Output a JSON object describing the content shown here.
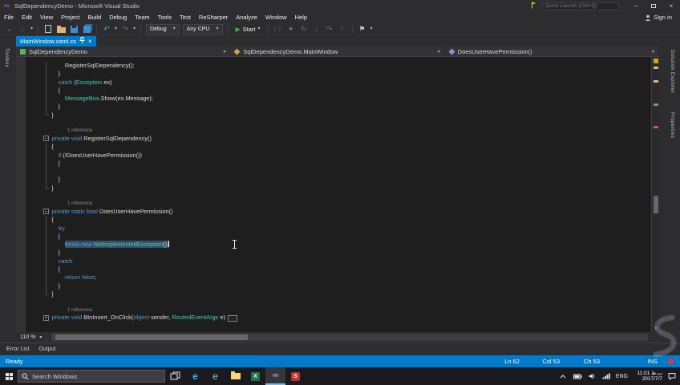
{
  "window": {
    "title": "SqlDependencyDemo - Microsoft Visual Studio",
    "quick_launch_placeholder": "Quick Launch (Ctrl+Q)",
    "sign_in_label": "Sign in"
  },
  "icons": {
    "chevron_down": "▾",
    "close": "×",
    "minimize": "–",
    "back": "←",
    "forward": "→",
    "undo": "↶",
    "redo": "↷",
    "play": "▶",
    "pause": "❘❘",
    "stop": "■",
    "restart": "↻",
    "step_into": "↓",
    "step_over": "↷",
    "step_out": "↑",
    "flag": "⚑",
    "scroll_up": "▲",
    "scroll_down": "▼",
    "infinity": "∞"
  },
  "menu": {
    "items": [
      "File",
      "Edit",
      "View",
      "Project",
      "Build",
      "Debug",
      "Team",
      "Tools",
      "Test",
      "ReSharper",
      "Analyze",
      "Window",
      "Help"
    ]
  },
  "toolbar": {
    "configuration": "Debug",
    "platform": "Any CPU",
    "start_label": "Start"
  },
  "tab_strip": {
    "tabs": [
      {
        "label": "MainWindow.xaml.cs",
        "active": true
      }
    ]
  },
  "navigation_bar": {
    "segments": [
      {
        "label": "SqlDependencyDemo",
        "icon": "csharp-project"
      },
      {
        "label": "SqlDependencyDemo.MainWindow",
        "icon": "class"
      },
      {
        "label": "DoesUserHavePermission()",
        "icon": "method"
      }
    ]
  },
  "side_rails": {
    "left": [
      "Toolbox"
    ],
    "right": [
      "Solution Explorer",
      "Properties"
    ]
  },
  "editor": {
    "zoom_level": "110 %",
    "lines": [
      {
        "fold": "bar",
        "segs": [
          [
            "pl",
            "                RegisterSqlDependency();"
          ]
        ]
      },
      {
        "fold": "bar",
        "segs": [
          [
            "pl",
            "            }"
          ]
        ]
      },
      {
        "fold": "bar",
        "segs": [
          [
            "kw",
            "            catch"
          ],
          [
            "pl",
            " ("
          ],
          [
            "ty",
            "Exception"
          ],
          [
            "pl",
            " ex)"
          ]
        ]
      },
      {
        "fold": "bar",
        "segs": [
          [
            "pl",
            "            {"
          ]
        ]
      },
      {
        "fold": "bar",
        "segs": [
          [
            "ty",
            "                MessageBox"
          ],
          [
            "pl",
            ".Show(ex.Message);"
          ]
        ]
      },
      {
        "fold": "bar",
        "segs": [
          [
            "pl",
            "            }"
          ]
        ]
      },
      {
        "fold": "corner",
        "segs": [
          [
            "pl",
            "        }"
          ]
        ]
      },
      {
        "segs": []
      },
      {
        "lens": true,
        "segs": [
          [
            "cl",
            "1 reference"
          ]
        ]
      },
      {
        "fold": "minus",
        "segs": [
          [
            "kw",
            "        private void "
          ],
          [
            "pl",
            "RegisterSqlDependency()"
          ]
        ]
      },
      {
        "fold": "bar",
        "segs": [
          [
            "pl",
            "        {"
          ]
        ]
      },
      {
        "fold": "bar",
        "segs": [
          [
            "kw",
            "            if"
          ],
          [
            "pl",
            " (!DoesUserHavePermission())"
          ]
        ]
      },
      {
        "fold": "bar",
        "segs": [
          [
            "pl",
            "            {"
          ]
        ]
      },
      {
        "fold": "bar",
        "segs": []
      },
      {
        "fold": "bar",
        "segs": [
          [
            "pl",
            "            }"
          ]
        ]
      },
      {
        "fold": "corner",
        "segs": [
          [
            "pl",
            "        }"
          ]
        ]
      },
      {
        "segs": []
      },
      {
        "lens": true,
        "segs": [
          [
            "cl",
            "1 reference"
          ]
        ]
      },
      {
        "fold": "minus",
        "segs": [
          [
            "kw",
            "        private static bool "
          ],
          [
            "pl",
            "DoesUserHavePermission()"
          ]
        ]
      },
      {
        "fold": "bar",
        "segs": [
          [
            "pl",
            "        {"
          ]
        ]
      },
      {
        "fold": "bar",
        "segs": [
          [
            "kw",
            "            try"
          ]
        ]
      },
      {
        "fold": "bar",
        "segs": [
          [
            "pl",
            "            {"
          ]
        ]
      },
      {
        "fold": "bar",
        "caret": true,
        "segs": [
          [
            "pl",
            "                "
          ],
          [
            "kw sel",
            "throw new "
          ],
          [
            "ty sel",
            "NotImplementedException"
          ],
          [
            "pl sel",
            "();"
          ]
        ]
      },
      {
        "fold": "bar",
        "segs": [
          [
            "pl",
            "            }"
          ]
        ]
      },
      {
        "fold": "bar",
        "segs": [
          [
            "kw",
            "            catch"
          ]
        ]
      },
      {
        "fold": "bar",
        "segs": [
          [
            "pl",
            "            {"
          ]
        ]
      },
      {
        "fold": "bar",
        "segs": [
          [
            "kw",
            "                return false"
          ],
          [
            "pl",
            ";"
          ]
        ]
      },
      {
        "fold": "bar",
        "segs": [
          [
            "pl",
            "            }"
          ]
        ]
      },
      {
        "fold": "corner",
        "segs": [
          [
            "pl",
            "        }"
          ]
        ]
      },
      {
        "segs": []
      },
      {
        "lens": true,
        "segs": [
          [
            "cl",
            "1 reference"
          ]
        ]
      },
      {
        "fold": "plus",
        "segs": [
          [
            "kw",
            "        private void "
          ],
          [
            "pl",
            "BtnInsert_OnClick("
          ],
          [
            "kw",
            "object"
          ],
          [
            "pl",
            " sender, "
          ],
          [
            "ty",
            "RoutedEventArgs"
          ],
          [
            "pl",
            " e)"
          ],
          [
            "bx",
            "..."
          ]
        ]
      }
    ],
    "scroll_marks": [
      {
        "pos": 0.035,
        "color": "#d7ba7d"
      },
      {
        "pos": 0.085,
        "color": "#d7ba7d"
      },
      {
        "pos": 0.17,
        "color": "#8a8a8a"
      },
      {
        "pos": 0.25,
        "color": "#e05252"
      }
    ],
    "thumb": {
      "pos": 0.505,
      "size": 0.065
    }
  },
  "bottom_panel": {
    "tabs": [
      "Error List",
      "Output"
    ]
  },
  "status_bar": {
    "message": "Ready",
    "line": "Ln 62",
    "column": "Col 53",
    "character": "Ch 53",
    "mode": "INS"
  },
  "taskbar": {
    "search_placeholder": "Search Windows",
    "apps": [
      {
        "name": "task-view"
      },
      {
        "name": "edge",
        "glyph": "e"
      },
      {
        "name": "internet-explorer",
        "glyph": "e"
      },
      {
        "name": "file-explorer"
      },
      {
        "name": "excel",
        "glyph": "X"
      },
      {
        "name": "visual-studio",
        "glyph": "∞",
        "active": true
      },
      {
        "name": "ssms",
        "glyph": "S"
      }
    ],
    "language": "ENG",
    "time": "11:01 ب.ظ",
    "date": "2017/7/7"
  },
  "colors": {
    "accent": "#007acc",
    "chrome_bg": "#2d2d30",
    "editor_bg": "#1e1e1e",
    "keyword": "#569cd6",
    "type": "#4ec9b0",
    "text": "#dcdcdc",
    "selection": "#355068",
    "codelens": "#8a8a8a",
    "status_bg": "#007acc"
  }
}
